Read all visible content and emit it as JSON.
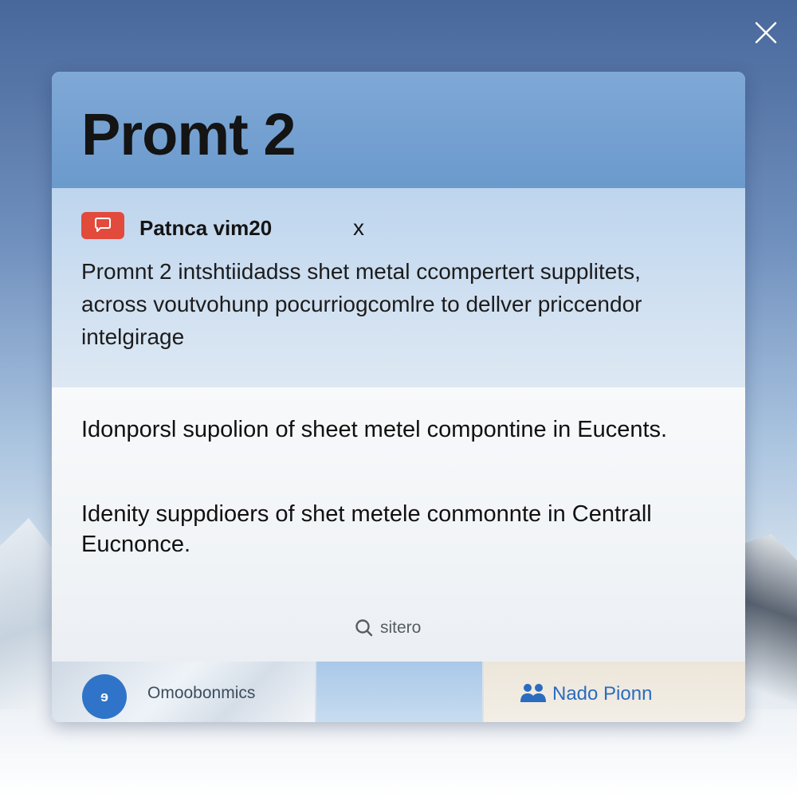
{
  "window": {
    "close_icon": "close-icon"
  },
  "card": {
    "title": "Promt 2",
    "message": {
      "icon": "chat-bubble-icon",
      "title": "Patnca vim20",
      "close_label": "x",
      "body": "Promnt 2  intshtiidadss shet metal ccompertert supplitets, across voutvohunp pocurriogcomlre to dellver priccendor intelgirage"
    },
    "results": [
      {
        "text": "Idonporsl supolion of sheet metel compontine in Eucents."
      },
      {
        "text": "Idenity suppdioers of shet metele conmonnte in Centrall Eucnonce."
      }
    ],
    "search": {
      "icon": "search-icon",
      "label": "sitero"
    },
    "bottom_bar": {
      "left_avatar": "ɘ",
      "left_label": "Omoobonmics",
      "right_icon": "people-icon",
      "right_label": "Nado Pionn"
    }
  },
  "colors": {
    "header": "#7fa8d6",
    "message_panel": "#c9dcef",
    "accent_red": "#e24a3c",
    "accent_blue": "#2f74c8"
  }
}
